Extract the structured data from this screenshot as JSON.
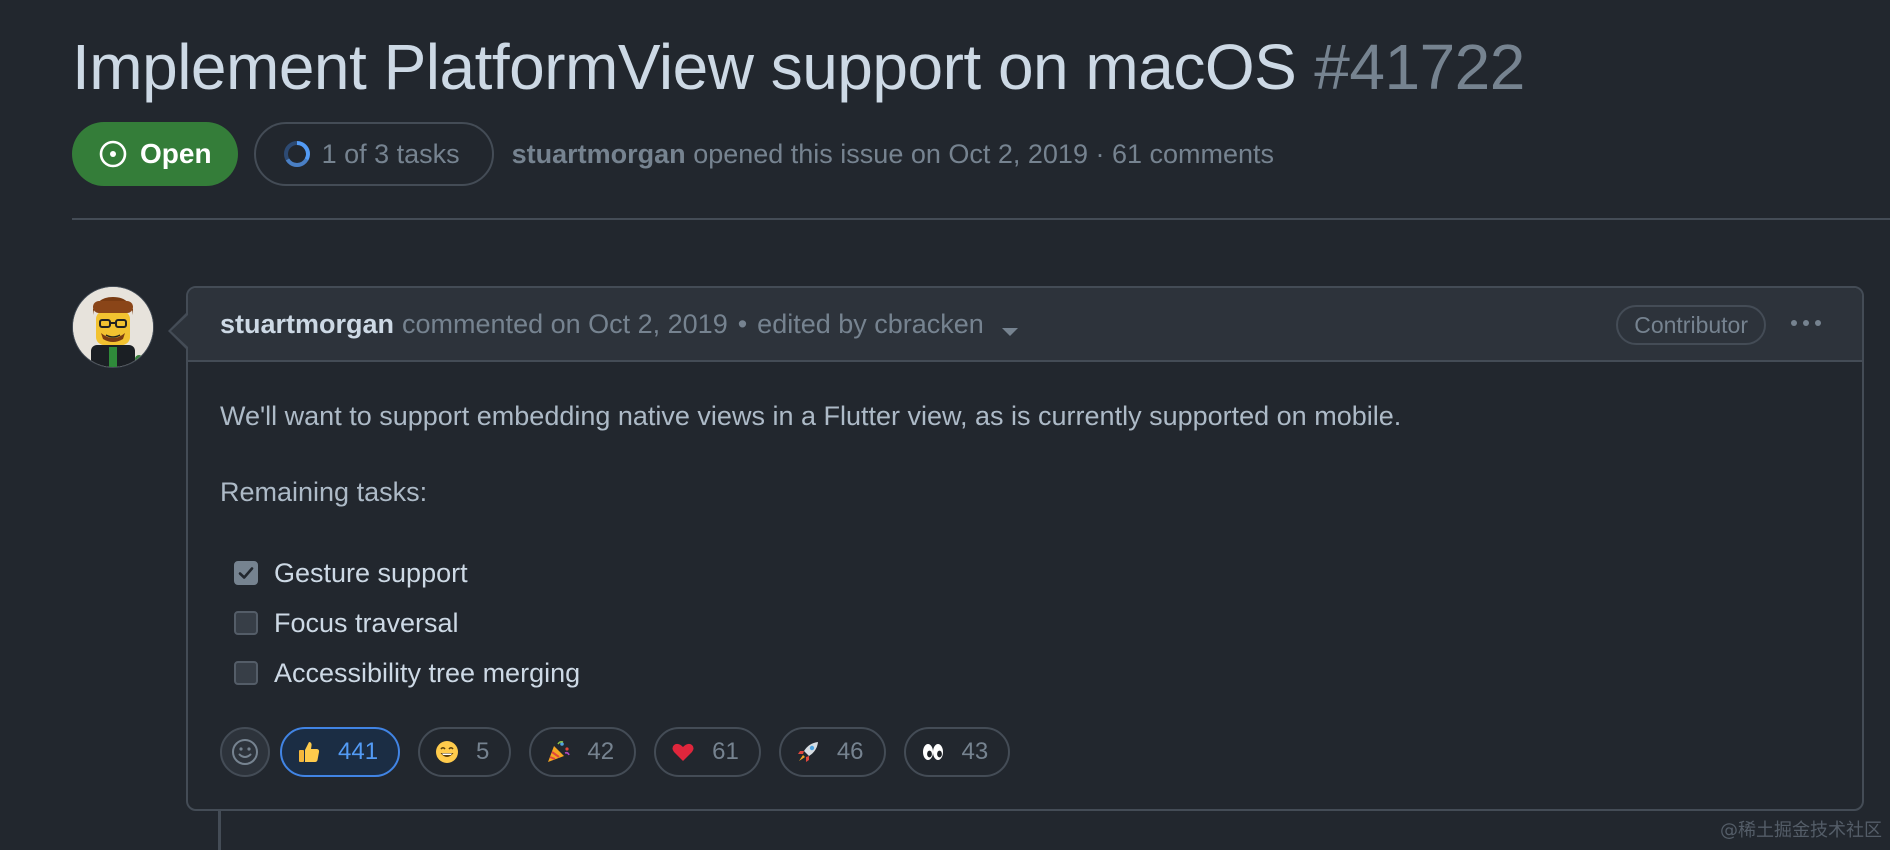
{
  "issue": {
    "title": "Implement PlatformView support on macOS",
    "number": "#41722",
    "state": "Open",
    "tasks": "1 of 3 tasks",
    "author": "stuartmorgan",
    "opened_text": "opened this issue on Oct 2, 2019 · 61 comments"
  },
  "comment": {
    "author": "stuartmorgan",
    "commented_text": "commented on Oct 2, 2019",
    "separator": "•",
    "edited_text": "edited by cbracken",
    "role": "Contributor",
    "body_intro": "We'll want to support embedding native views in a Flutter view, as is currently supported on mobile.",
    "remaining_label": "Remaining tasks:",
    "tasks": [
      {
        "label": "Gesture support",
        "checked": true
      },
      {
        "label": "Focus traversal",
        "checked": false
      },
      {
        "label": "Accessibility tree merging",
        "checked": false
      }
    ],
    "reactions": [
      {
        "emoji": "thumbs-up",
        "count": "441",
        "active": true
      },
      {
        "emoji": "laugh",
        "count": "5",
        "active": false
      },
      {
        "emoji": "hooray",
        "count": "42",
        "active": false
      },
      {
        "emoji": "heart",
        "count": "61",
        "active": false
      },
      {
        "emoji": "rocket",
        "count": "46",
        "active": false
      },
      {
        "emoji": "eyes",
        "count": "43",
        "active": false
      }
    ]
  },
  "watermark": "@稀土掘金技术社区",
  "colors": {
    "open_green": "#347d39",
    "active_blue": "#539bf5",
    "background": "#22272e"
  }
}
